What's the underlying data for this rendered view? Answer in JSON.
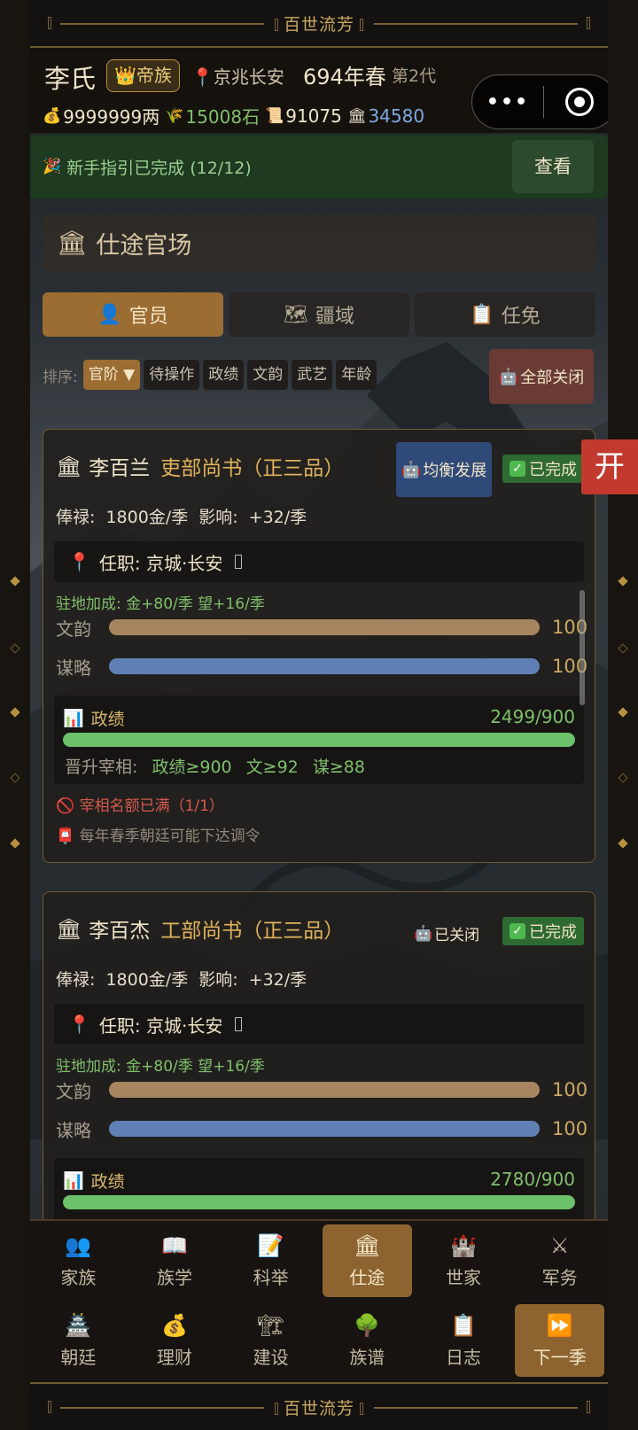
{
  "frame": {
    "title": "百世流芳"
  },
  "header": {
    "clan": "李氏",
    "rank_badge": "帝族",
    "location": "京兆长安",
    "year": "694年春",
    "generation": "第2代",
    "resources": {
      "gold": "9999999两",
      "grain": "15008石",
      "scrolls": "91075",
      "prestige": "34580"
    }
  },
  "guide": {
    "text": "新手指引已完成 (12/12)",
    "button": "查看"
  },
  "section": {
    "title": "仕途官场"
  },
  "tabs": [
    {
      "label": "官员",
      "icon": "person-icon"
    },
    {
      "label": "疆域",
      "icon": "map-icon"
    },
    {
      "label": "任免",
      "icon": "clipboard-icon"
    }
  ],
  "sort": {
    "label": "排序:",
    "options": [
      "官阶 ▼",
      "待操作",
      "政绩",
      "文韵",
      "武艺",
      "年龄"
    ],
    "close_all": "全部关闭"
  },
  "open_button": "开",
  "officials": [
    {
      "name": "李百兰",
      "position": "吏部尚书（正三品）",
      "strategy": "均衡发展",
      "status": "已完成",
      "salary": "俸禄: 1800金/季   影响: +32/季",
      "post": "任职: 京城·长安",
      "bonus": "驻地加成: 金+80/季  望+16/季",
      "stats": [
        {
          "label": "文韵",
          "value": "100"
        },
        {
          "label": "谋略",
          "value": "100"
        }
      ],
      "performance_label": "政绩",
      "performance": "2499/900",
      "performance_fraction": 1.0,
      "promotion_prefix": "晋升宰相:",
      "promotion_reqs": "政绩≥900  文≥92  谋≥88",
      "warning": "宰相名额已满（1/1）",
      "note": "每年春季朝廷可能下达调令"
    },
    {
      "name": "李百杰",
      "position": "工部尚书（正三品）",
      "strategy": "已关闭",
      "status": "已完成",
      "salary": "俸禄: 1800金/季   影响: +32/季",
      "post": "任职: 京城·长安",
      "bonus": "驻地加成: 金+80/季  望+16/季",
      "stats": [
        {
          "label": "文韵",
          "value": "100"
        },
        {
          "label": "谋略",
          "value": "100"
        }
      ],
      "performance_label": "政绩",
      "performance": "2780/900",
      "performance_fraction": 1.0
    }
  ],
  "nav": [
    {
      "label": "家族",
      "icon": "family-icon"
    },
    {
      "label": "族学",
      "icon": "book-icon"
    },
    {
      "label": "科举",
      "icon": "exam-icon"
    },
    {
      "label": "仕途",
      "icon": "government-icon"
    },
    {
      "label": "世家",
      "icon": "castle-icon"
    },
    {
      "label": "军务",
      "icon": "swords-icon"
    },
    {
      "label": "朝廷",
      "icon": "palace-icon"
    },
    {
      "label": "理财",
      "icon": "money-bag-icon"
    },
    {
      "label": "建设",
      "icon": "crane-icon"
    },
    {
      "label": "族谱",
      "icon": "tree-icon"
    },
    {
      "label": "日志",
      "icon": "log-icon"
    },
    {
      "label": "下一季",
      "icon": "fast-forward-icon"
    }
  ],
  "colors": {
    "accent": "#9b6d33",
    "gold_text": "#e0b25a",
    "green": "#6cc16a",
    "wenyun_bar": "#a68560",
    "moulve_bar": "#5f80b5",
    "danger": "#c23a2e"
  }
}
